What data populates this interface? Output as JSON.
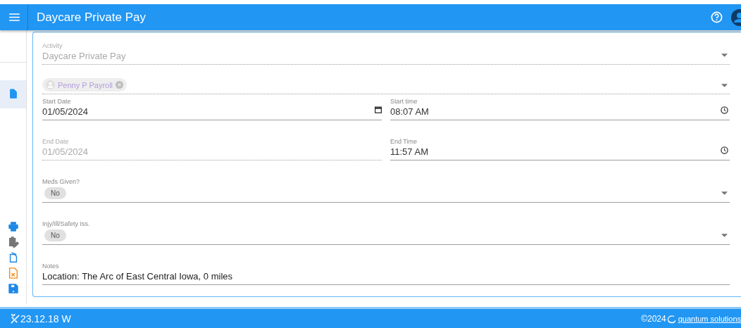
{
  "app_bar": {
    "title": "Daycare Private Pay"
  },
  "sidebar": {
    "items": [
      {
        "selected": true
      }
    ]
  },
  "form": {
    "rows": [
      {
        "kind": "select",
        "label": "Activity",
        "value": "Daycare Private Pay",
        "disabled": true
      },
      {
        "kind": "person",
        "chips": [
          "Penny P Payroll"
        ],
        "disabled": true
      },
      {
        "kind": "pair",
        "left": {
          "label": "Start Date",
          "value": "01/05/2024",
          "disabled": false
        },
        "right": {
          "label": "Start time",
          "value": "08:07 AM"
        }
      },
      {
        "kind": "pair",
        "left": {
          "label": "End Date",
          "value": "01/05/2024",
          "disabled": true
        },
        "right": {
          "label": "End Time",
          "value": "11:57 AM"
        }
      },
      {
        "kind": "chip-select",
        "label": "Meds Given?",
        "chips": [
          "No"
        ]
      },
      {
        "kind": "chip-select",
        "label": "Injy/Ill/Safety Iss.",
        "chips": [
          "No"
        ]
      },
      {
        "kind": "text",
        "label": "Notes",
        "value": "Location: The Arc of East Central Iowa, 0 miles"
      }
    ]
  },
  "footer": {
    "version": "23.12.18 W",
    "copyright": "©2024",
    "brand": "quantum solutions"
  }
}
